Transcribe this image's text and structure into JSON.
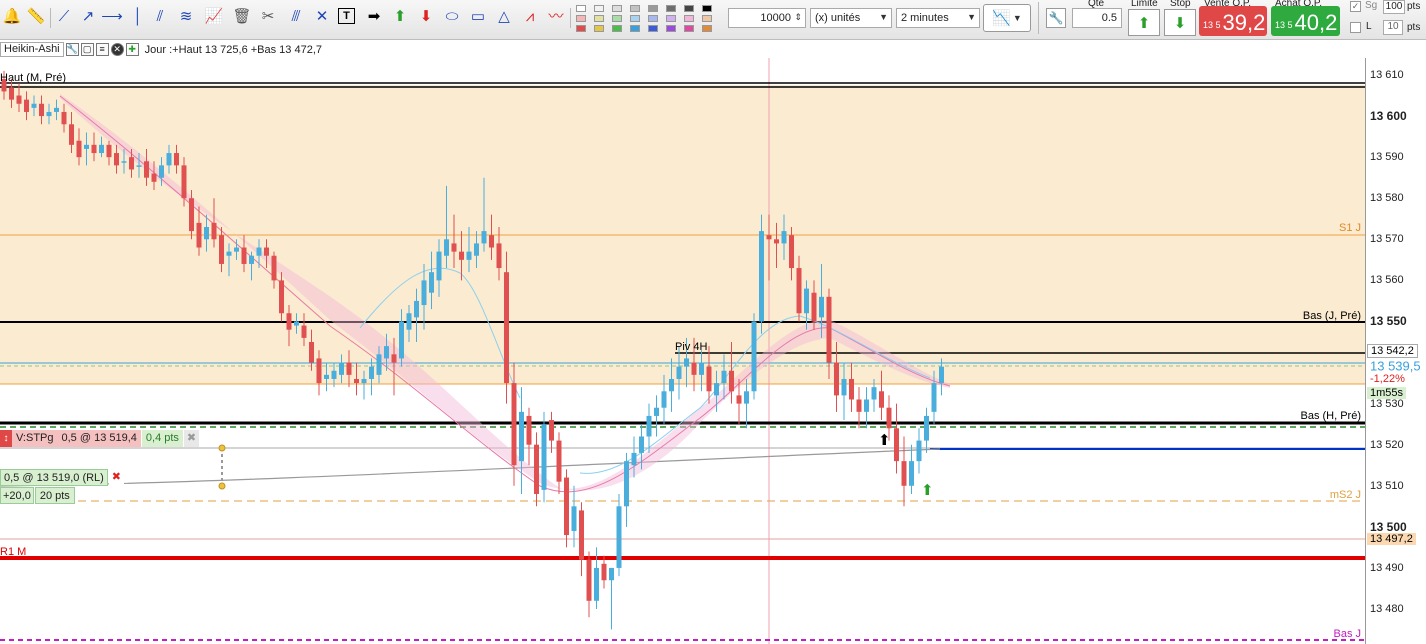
{
  "toolbar": {
    "quantity_value": "10000",
    "unit_select": "(x) unités",
    "period_select": "2 minutes",
    "qty_label": "Qté",
    "qty_value": "0.5",
    "limit_label": "Limite",
    "stop_label": "Stop",
    "sell_label": "Vente O.P.",
    "sell_prefix": "13 5",
    "sell_price": "39,2",
    "buy_label": "Achat O.P.",
    "buy_prefix": "13 5",
    "buy_price": "40,2",
    "sg_label": "Sg",
    "sg_value": "100",
    "sg_unit": "pts",
    "l_label": "L",
    "l_value": "10",
    "l_unit": "pts",
    "colors": {
      "sell": "#e04848",
      "buy": "#2eaa3e"
    },
    "swatches": [
      "#ffffff",
      "#f2f2f2",
      "#dddddd",
      "#c2c2c2",
      "#9a9a9a",
      "#6e6e6e",
      "#444444",
      "#000000",
      "#f4b6b6",
      "#e2e2a0",
      "#a8dca8",
      "#a8d2ee",
      "#a8b8ee",
      "#d0b0ee",
      "#f2b6d8",
      "#eec8a6",
      "#e24b4b",
      "#e0c64a",
      "#4bbd4b",
      "#3aa0dc",
      "#3a5cdc",
      "#9a4bdc",
      "#dc4ba0",
      "#e08a3a"
    ]
  },
  "info_bar": {
    "indicator": "Heikin-Ashi",
    "day_text": "Jour :+Haut 13 725,6 +Bas 13 472,7"
  },
  "axis": {
    "ticks": [
      {
        "label": "13 610",
        "bold": false,
        "value": 13610
      },
      {
        "label": "13 600",
        "bold": true,
        "value": 13600
      },
      {
        "label": "13 590",
        "bold": false,
        "value": 13590
      },
      {
        "label": "13 580",
        "bold": false,
        "value": 13580
      },
      {
        "label": "13 570",
        "bold": false,
        "value": 13570
      },
      {
        "label": "13 560",
        "bold": false,
        "value": 13560
      },
      {
        "label": "13 550",
        "bold": true,
        "value": 13550
      },
      {
        "label": "13 530",
        "bold": false,
        "value": 13530
      },
      {
        "label": "13 520",
        "bold": false,
        "value": 13520
      },
      {
        "label": "13 510",
        "bold": false,
        "value": 13510
      },
      {
        "label": "13 500",
        "bold": true,
        "value": 13500
      },
      {
        "label": "13 490",
        "bold": false,
        "value": 13490
      },
      {
        "label": "13 480",
        "bold": false,
        "value": 13480
      }
    ],
    "tags": {
      "level_542": "13 542,2",
      "price": "13 539,5",
      "change": "-1,22%",
      "timer": "1m55s",
      "level_497": "13 497,2"
    }
  },
  "levels": {
    "haut_m": "Haut (M, Pré)",
    "s1_j": "S1 J",
    "bas_j_pre": "Bas (J, Pré)",
    "piv_4h": "Piv 4H",
    "bas_h_pre": "Bas (H, Pré)",
    "ms2_j": "mS2 J",
    "r1_m": "R1 M",
    "bas_j": "Bas J"
  },
  "orders": {
    "stop_label": "V:STPg",
    "stop_detail": "0,5 @ 13 519,4",
    "stop_dist": "0,4 pts",
    "pos_detail": "0,5 @ 13 519,0 (RL)",
    "pos_gain": "+20,0",
    "pos_pts": "20 pts"
  },
  "chart_data": {
    "type": "candlestick",
    "title": "Heikin-Ashi",
    "timeframe": "2 minutes",
    "ylim": [
      13474,
      13614
    ],
    "candles": [
      [
        13609,
        13611,
        13604,
        13606
      ],
      [
        13607,
        13609,
        13602,
        13604
      ],
      [
        13605,
        13608,
        13601,
        13603
      ],
      [
        13604,
        13606,
        13599,
        13601
      ],
      [
        13602,
        13605,
        13600,
        13603
      ],
      [
        13603,
        13605,
        13598,
        13600
      ],
      [
        13600,
        13603,
        13598,
        13601
      ],
      [
        13601,
        13604,
        13599,
        13602
      ],
      [
        13601,
        13603,
        13596,
        13598
      ],
      [
        13598,
        13601,
        13591,
        13593
      ],
      [
        13594,
        13597,
        13588,
        13590
      ],
      [
        13592,
        13596,
        13588,
        13593
      ],
      [
        13593,
        13596,
        13589,
        13591
      ],
      [
        13591,
        13595,
        13590,
        13593
      ],
      [
        13593,
        13594,
        13588,
        13590
      ],
      [
        13591,
        13593,
        13586,
        13588
      ],
      [
        13589,
        13592,
        13586,
        13589
      ],
      [
        13590,
        13592,
        13585,
        13587
      ],
      [
        13588,
        13591,
        13585,
        13588
      ],
      [
        13589,
        13592,
        13583,
        13585
      ],
      [
        13586,
        13589,
        13582,
        13584
      ],
      [
        13585,
        13590,
        13583,
        13588
      ],
      [
        13588,
        13593,
        13586,
        13591
      ],
      [
        13591,
        13593,
        13586,
        13588
      ],
      [
        13588,
        13590,
        13578,
        13580
      ],
      [
        13580,
        13582,
        13570,
        13572
      ],
      [
        13574,
        13578,
        13566,
        13568
      ],
      [
        13570,
        13576,
        13567,
        13573
      ],
      [
        13574,
        13580,
        13568,
        13570
      ],
      [
        13571,
        13573,
        13562,
        13564
      ],
      [
        13566,
        13569,
        13561,
        13567
      ],
      [
        13567,
        13570,
        13565,
        13568
      ],
      [
        13568,
        13571,
        13562,
        13564
      ],
      [
        13564,
        13567,
        13560,
        13566
      ],
      [
        13566,
        13570,
        13563,
        13568
      ],
      [
        13568,
        13570,
        13563,
        13566
      ],
      [
        13566,
        13567,
        13558,
        13560
      ],
      [
        13560,
        13562,
        13550,
        13552
      ],
      [
        13552,
        13554,
        13544,
        13548
      ],
      [
        13549,
        13552,
        13547,
        13550
      ],
      [
        13549,
        13552,
        13544,
        13546
      ],
      [
        13545,
        13548,
        13538,
        13540
      ],
      [
        13541,
        13543,
        13532,
        13535
      ],
      [
        13536,
        13540,
        13533,
        13537
      ],
      [
        13536,
        13540,
        13534,
        13538
      ],
      [
        13537,
        13542,
        13535,
        13540
      ],
      [
        13540,
        13543,
        13534,
        13537
      ],
      [
        13536,
        13540,
        13532,
        13535
      ],
      [
        13535,
        13538,
        13531,
        13536
      ],
      [
        13536,
        13541,
        13532,
        13539
      ],
      [
        13537,
        13544,
        13535,
        13542
      ],
      [
        13541,
        13547,
        13538,
        13544
      ],
      [
        13542,
        13546,
        13532,
        13540
      ],
      [
        13541,
        13553,
        13539,
        13550
      ],
      [
        13548,
        13554,
        13545,
        13552
      ],
      [
        13551,
        13558,
        13545,
        13555
      ],
      [
        13554,
        13564,
        13548,
        13560
      ],
      [
        13557,
        13567,
        13553,
        13562
      ],
      [
        13560,
        13570,
        13556,
        13567
      ],
      [
        13566,
        13583,
        13563,
        13570
      ],
      [
        13569,
        13576,
        13563,
        13567
      ],
      [
        13567,
        13572,
        13560,
        13565
      ],
      [
        13565,
        13573,
        13562,
        13567
      ],
      [
        13566,
        13572,
        13563,
        13569
      ],
      [
        13569,
        13585,
        13567,
        13572
      ],
      [
        13571,
        13576,
        13565,
        13568
      ],
      [
        13569,
        13573,
        13560,
        13563
      ],
      [
        13562,
        13567,
        13530,
        13535
      ],
      [
        13535,
        13540,
        13510,
        13515
      ],
      [
        13516,
        13534,
        13508,
        13528
      ],
      [
        13527,
        13529,
        13515,
        13520
      ],
      [
        13520,
        13523,
        13505,
        13508
      ],
      [
        13509,
        13528,
        13506,
        13525
      ],
      [
        13526,
        13528,
        13518,
        13521
      ],
      [
        13521,
        13523,
        13508,
        13511
      ],
      [
        13512,
        13514,
        13495,
        13498
      ],
      [
        13499,
        13510,
        13495,
        13505
      ],
      [
        13504,
        13506,
        13488,
        13492
      ],
      [
        13492,
        13494,
        13478,
        13482
      ],
      [
        13482,
        13495,
        13480,
        13490
      ],
      [
        13491,
        13493,
        13485,
        13487
      ],
      [
        13487,
        13490,
        13475,
        13490
      ],
      [
        13490,
        13508,
        13488,
        13505
      ],
      [
        13505,
        13518,
        13500,
        13516
      ],
      [
        13515,
        13522,
        13512,
        13518
      ],
      [
        13518,
        13525,
        13514,
        13522
      ],
      [
        13522,
        13530,
        13518,
        13527
      ],
      [
        13527,
        13532,
        13522,
        13529
      ],
      [
        13529,
        13537,
        13525,
        13533
      ],
      [
        13533,
        13541,
        13528,
        13536
      ],
      [
        13536,
        13544,
        13531,
        13539
      ],
      [
        13539,
        13546,
        13534,
        13541
      ],
      [
        13540,
        13546,
        13533,
        13537
      ],
      [
        13537,
        13543,
        13533,
        13540
      ],
      [
        13539,
        13544,
        13530,
        13533
      ],
      [
        13532,
        13538,
        13528,
        13535
      ],
      [
        13535,
        13542,
        13531,
        13538
      ],
      [
        13538,
        13545,
        13530,
        13533
      ],
      [
        13532,
        13536,
        13525,
        13530
      ],
      [
        13530,
        13536,
        13524,
        13533
      ],
      [
        13533,
        13552,
        13531,
        13550
      ],
      [
        13550,
        13576,
        13547,
        13572
      ],
      [
        13571,
        13576,
        13560,
        13570
      ],
      [
        13570,
        13574,
        13563,
        13569
      ],
      [
        13569,
        13576,
        13565,
        13572
      ],
      [
        13571,
        13573,
        13560,
        13563
      ],
      [
        13563,
        13566,
        13550,
        13552
      ],
      [
        13552,
        13560,
        13548,
        13558
      ],
      [
        13557,
        13560,
        13548,
        13550
      ],
      [
        13551,
        13564,
        13546,
        13556
      ],
      [
        13556,
        13558,
        13536,
        13540
      ],
      [
        13540,
        13545,
        13528,
        13532
      ],
      [
        13532,
        13540,
        13526,
        13536
      ],
      [
        13536,
        13540,
        13528,
        13531
      ],
      [
        13531,
        13534,
        13524,
        13528
      ],
      [
        13528,
        13534,
        13524,
        13531
      ],
      [
        13531,
        13536,
        13528,
        13534
      ],
      [
        13533,
        13538,
        13526,
        13529
      ],
      [
        13529,
        13532,
        13521,
        13524
      ],
      [
        13524,
        13530,
        13513,
        13516
      ],
      [
        13516,
        13522,
        13505,
        13510
      ],
      [
        13510,
        13520,
        13508,
        13516
      ],
      [
        13516,
        13524,
        13513,
        13521
      ],
      [
        13521,
        13529,
        13518,
        13527
      ],
      [
        13528,
        13538,
        13525,
        13535
      ],
      [
        13535,
        13541,
        13532,
        13539
      ]
    ]
  }
}
